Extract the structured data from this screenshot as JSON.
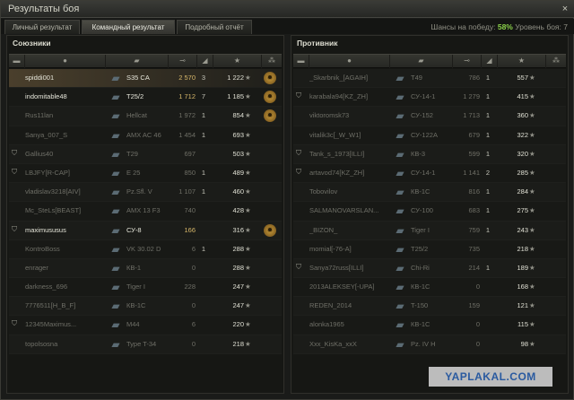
{
  "window": {
    "title": "Результаты боя",
    "close_icon": "×"
  },
  "tabs": [
    {
      "label": "Личный результат"
    },
    {
      "label": "Командный результат"
    },
    {
      "label": "Подробный отчёт"
    }
  ],
  "win_chance": {
    "prefix": "Шансы на победу:",
    "value": "58%",
    "suffix": "Уровень боя: 7"
  },
  "allies": {
    "title": "Союзники",
    "rows": [
      {
        "name": "spiddi001",
        "vehicle": "S35 CA",
        "damage": "2 570",
        "kills": "3",
        "exp": "1 222",
        "medal": true,
        "alive": true,
        "me": true,
        "badge": ""
      },
      {
        "name": "indomitable48",
        "vehicle": "T25/2",
        "damage": "1 712",
        "kills": "7",
        "exp": "1 185",
        "medal": true,
        "alive": true,
        "badge": ""
      },
      {
        "name": "Rus11lan",
        "vehicle": "Hellcat",
        "damage": "1 972",
        "kills": "1",
        "exp": "854",
        "medal": true,
        "alive": false,
        "badge": ""
      },
      {
        "name": "Sanya_007_S",
        "vehicle": "AMX AC 46",
        "damage": "1 454",
        "kills": "1",
        "exp": "693",
        "medal": false,
        "alive": false,
        "badge": ""
      },
      {
        "name": "Gallius40",
        "vehicle": "T29",
        "damage": "697",
        "kills": "",
        "exp": "503",
        "medal": false,
        "alive": false,
        "badge": "⛉"
      },
      {
        "name": "LBJFY[R-CAP]",
        "vehicle": "E 25",
        "damage": "850",
        "kills": "1",
        "exp": "489",
        "medal": false,
        "alive": false,
        "badge": "⛉"
      },
      {
        "name": "vladislav3218[AIV]",
        "vehicle": "Pz.Sfl. V",
        "damage": "1 107",
        "kills": "1",
        "exp": "460",
        "medal": false,
        "alive": false,
        "badge": ""
      },
      {
        "name": "Mc_SteLs[BEAST]",
        "vehicle": "AMX 13 F3",
        "damage": "740",
        "kills": "",
        "exp": "428",
        "medal": false,
        "alive": false,
        "badge": ""
      },
      {
        "name": "maximususus",
        "vehicle": "СУ-8",
        "damage": "166",
        "kills": "",
        "exp": "316",
        "medal": true,
        "alive": true,
        "badge": "⛉"
      },
      {
        "name": "KontroBoss",
        "vehicle": "VK 30.02 D",
        "damage": "6",
        "kills": "1",
        "exp": "288",
        "medal": false,
        "alive": false,
        "badge": ""
      },
      {
        "name": "enrager",
        "vehicle": "КВ-1",
        "damage": "0",
        "kills": "",
        "exp": "288",
        "medal": false,
        "alive": false,
        "badge": ""
      },
      {
        "name": "darkness_696",
        "vehicle": "Tiger I",
        "damage": "228",
        "kills": "",
        "exp": "247",
        "medal": false,
        "alive": false,
        "badge": ""
      },
      {
        "name": "7776511[H_B_F]",
        "vehicle": "КВ-1С",
        "damage": "0",
        "kills": "",
        "exp": "247",
        "medal": false,
        "alive": false,
        "badge": ""
      },
      {
        "name": "12345Maximus...",
        "vehicle": "M44",
        "damage": "6",
        "kills": "",
        "exp": "220",
        "medal": false,
        "alive": false,
        "badge": "⛉"
      },
      {
        "name": "topolsosna",
        "vehicle": "Type T-34",
        "damage": "0",
        "kills": "",
        "exp": "218",
        "medal": false,
        "alive": false,
        "badge": ""
      }
    ]
  },
  "enemies": {
    "title": "Противник",
    "rows": [
      {
        "name": "_Skarbnik_[AGAIH]",
        "vehicle": "T49",
        "damage": "786",
        "kills": "1",
        "exp": "557",
        "alive": false,
        "badge": ""
      },
      {
        "name": "karabala94[KZ_ZH]",
        "vehicle": "СУ-14-1",
        "damage": "1 279",
        "kills": "1",
        "exp": "415",
        "alive": false,
        "badge": "⛉"
      },
      {
        "name": "viktoromsk73",
        "vehicle": "СУ-152",
        "damage": "1 713",
        "kills": "1",
        "exp": "360",
        "alive": false,
        "badge": ""
      },
      {
        "name": "vitalik3c[_W_W1]",
        "vehicle": "СУ-122А",
        "damage": "679",
        "kills": "1",
        "exp": "322",
        "alive": false,
        "badge": ""
      },
      {
        "name": "Tank_s_1973[ILLI]",
        "vehicle": "КВ-3",
        "damage": "599",
        "kills": "1",
        "exp": "320",
        "alive": false,
        "badge": "⛉"
      },
      {
        "name": "artavod74[KZ_ZH]",
        "vehicle": "СУ-14-1",
        "damage": "1 141",
        "kills": "2",
        "exp": "285",
        "alive": false,
        "badge": "⛉"
      },
      {
        "name": "Tobovilov",
        "vehicle": "КВ-1С",
        "damage": "816",
        "kills": "1",
        "exp": "284",
        "alive": false,
        "badge": ""
      },
      {
        "name": "SALMANOVARSLAN...",
        "vehicle": "СУ-100",
        "damage": "683",
        "kills": "1",
        "exp": "275",
        "alive": false,
        "badge": ""
      },
      {
        "name": "_BIZON_",
        "vehicle": "Tiger I",
        "damage": "759",
        "kills": "1",
        "exp": "243",
        "alive": false,
        "badge": ""
      },
      {
        "name": "momial[-76-A]",
        "vehicle": "T25/2",
        "damage": "735",
        "kills": "",
        "exp": "218",
        "alive": false,
        "badge": ""
      },
      {
        "name": "Sanya72russ[ILLI]",
        "vehicle": "Chi-Ri",
        "damage": "214",
        "kills": "1",
        "exp": "189",
        "alive": false,
        "badge": "⛉"
      },
      {
        "name": "2013ALEKSEY[-UPA]",
        "vehicle": "КВ-1С",
        "damage": "0",
        "kills": "",
        "exp": "168",
        "alive": false,
        "badge": ""
      },
      {
        "name": "REDEN_2014",
        "vehicle": "T-150",
        "damage": "159",
        "kills": "",
        "exp": "121",
        "alive": false,
        "badge": ""
      },
      {
        "name": "alonka1965",
        "vehicle": "КВ-1С",
        "damage": "0",
        "kills": "",
        "exp": "115",
        "alive": false,
        "badge": ""
      },
      {
        "name": "Xxx_KisKa_xxX",
        "vehicle": "Pz. IV H",
        "damage": "0",
        "kills": "",
        "exp": "98",
        "alive": false,
        "badge": ""
      }
    ]
  },
  "columns": {
    "squad_icon": "▬",
    "player_icon": "●",
    "vehicle_icon": "▰",
    "damage_icon": "⊸",
    "kills_icon": "◢",
    "exp_icon": "★",
    "medal_icon": "⁂"
  },
  "star_symbol": "★",
  "medal_symbol": "✹",
  "tank_symbol": "▰",
  "watermark": "YAPLAKAL.COM"
}
